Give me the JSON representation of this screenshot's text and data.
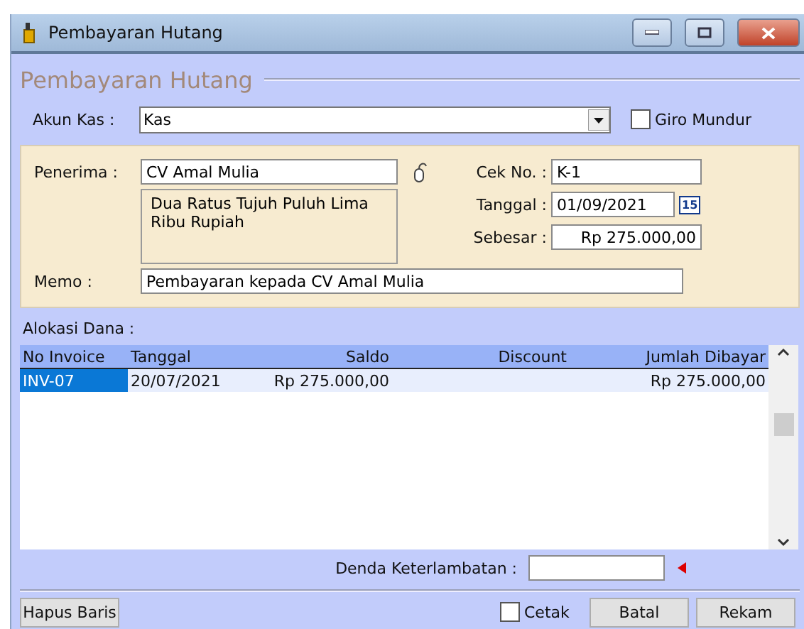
{
  "window": {
    "title": "Pembayaran Hutang"
  },
  "heading": "Pembayaran Hutang",
  "akun_kas": {
    "label": "Akun Kas :",
    "value": "Kas"
  },
  "giro_mundur": {
    "label": "Giro Mundur",
    "checked": false
  },
  "penerima": {
    "label": "Penerima :",
    "value": "CV Amal Mulia",
    "terbilang": "Dua Ratus Tujuh Puluh Lima Ribu Rupiah"
  },
  "cek_no": {
    "label": "Cek No. :",
    "value": "K-1"
  },
  "tanggal": {
    "label": "Tanggal :",
    "value": "01/09/2021",
    "calendar_icon": "15"
  },
  "sebesar": {
    "label": "Sebesar :",
    "value": "Rp 275.000,00"
  },
  "memo": {
    "label": "Memo :",
    "value": "Pembayaran kepada CV Amal Mulia"
  },
  "alokasi_label": "Alokasi Dana :",
  "table": {
    "columns": [
      "No Invoice",
      "Tanggal",
      "Saldo",
      "Discount",
      "Jumlah Dibayar"
    ],
    "rows": [
      {
        "cells": [
          "INV-07",
          "20/07/2021",
          "Rp 275.000,00",
          null,
          "Rp 275.000,00"
        ],
        "selected": true
      }
    ]
  },
  "denda": {
    "label": "Denda Keterlambatan :"
  },
  "buttons": {
    "hapus": "Hapus Baris",
    "batal": "Batal",
    "rekam": "Rekam"
  },
  "cetak": {
    "label": "Cetak",
    "checked": false
  }
}
